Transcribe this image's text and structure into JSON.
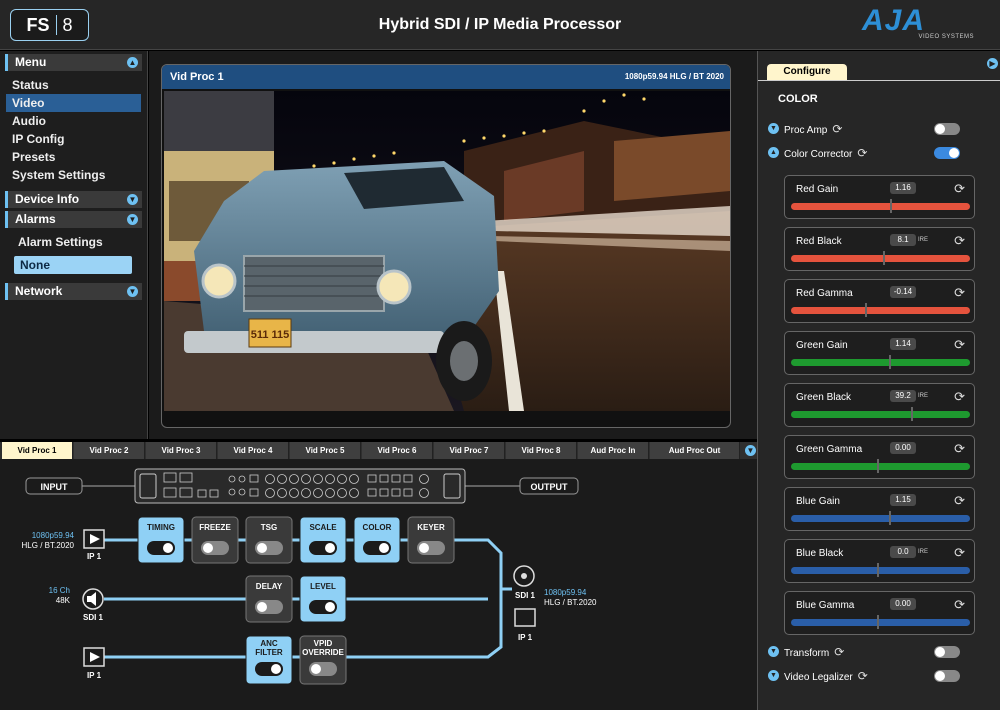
{
  "header": {
    "logo_left": "FS",
    "logo_right": "8",
    "title": "Hybrid SDI / IP Media Processor",
    "brand": "AJA",
    "brand_sub": "VIDEO SYSTEMS"
  },
  "sidebar": {
    "menu_label": "Menu",
    "items": [
      "Status",
      "Video",
      "Audio",
      "IP Config",
      "Presets",
      "System Settings"
    ],
    "device_info": "Device Info",
    "alarms": "Alarms",
    "alarm_settings": "Alarm Settings",
    "alarm_value": "None",
    "network": "Network"
  },
  "viewer": {
    "title": "Vid Proc 1",
    "format": "1080p59.94 HLG / BT 2020",
    "plate": "511 115"
  },
  "tabs": [
    "Vid Proc 1",
    "Vid Proc 2",
    "Vid Proc 3",
    "Vid Proc 4",
    "Vid Proc 5",
    "Vid Proc 6",
    "Vid Proc 7",
    "Vid Proc 8",
    "Aud Proc In",
    "Aud Proc Out"
  ],
  "flow": {
    "input": "INPUT",
    "output": "OUTPUT",
    "in1_fmt1": "1080p59.94",
    "in1_fmt2": "HLG / BT.2020",
    "in1_name": "IP 1",
    "in2_fmt1": "16 Ch",
    "in2_fmt2": "48K",
    "in2_name": "SDI 1",
    "in3_name": "IP 1",
    "out_sdi": "SDI 1",
    "out_ip": "IP 1",
    "out_fmt1": "1080p59.94",
    "out_fmt2": "HLG / BT.2020",
    "blocks": {
      "timing": "TIMING",
      "freeze": "FREEZE",
      "tsg": "TSG",
      "scale": "SCALE",
      "color": "COLOR",
      "keyer": "KEYER",
      "delay": "DELAY",
      "level": "LEVEL",
      "anc1": "ANC",
      "anc2": "FILTER",
      "vpid1": "VPID",
      "vpid2": "OVERRIDE"
    }
  },
  "configure": {
    "tab": "Configure",
    "section": "COLOR",
    "proc_amp": "Proc Amp",
    "color_corrector": "Color Corrector",
    "transform": "Transform",
    "video_legalizer": "Video Legalizer",
    "params": [
      {
        "name": "Red Gain",
        "value": "1.16",
        "unit": ""
      },
      {
        "name": "Red Black",
        "value": "8.1",
        "unit": "IRE"
      },
      {
        "name": "Red Gamma",
        "value": "-0.14",
        "unit": ""
      },
      {
        "name": "Green Gain",
        "value": "1.14",
        "unit": ""
      },
      {
        "name": "Green Black",
        "value": "39.2",
        "unit": "IRE"
      },
      {
        "name": "Green Gamma",
        "value": "0.00",
        "unit": ""
      },
      {
        "name": "Blue Gain",
        "value": "1.15",
        "unit": ""
      },
      {
        "name": "Blue Black",
        "value": "0.0",
        "unit": "IRE"
      },
      {
        "name": "Blue Gamma",
        "value": "0.00",
        "unit": ""
      }
    ]
  },
  "colors": {
    "accent": "#6ec1f2",
    "red": "#e5533d",
    "green": "#1e9a2f",
    "blue": "#2a5ea8",
    "active_block": "#8fd0f5"
  }
}
